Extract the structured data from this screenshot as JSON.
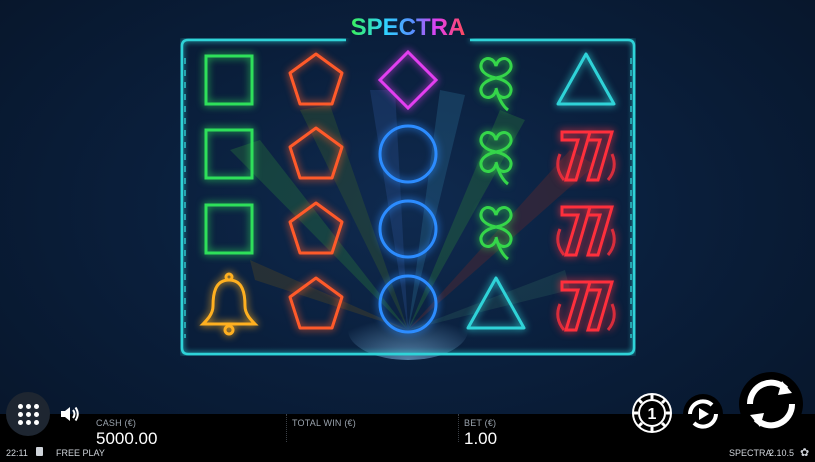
{
  "game": {
    "logo_text": "SPECTRA",
    "reels": [
      [
        "square",
        "square",
        "square",
        "bell"
      ],
      [
        "pentagon",
        "pentagon",
        "pentagon",
        "pentagon"
      ],
      [
        "diamond",
        "circle",
        "circle",
        "circle"
      ],
      [
        "clover",
        "clover",
        "clover",
        "triangle"
      ],
      [
        "triangle",
        "seven",
        "seven",
        "seven"
      ]
    ],
    "symbol_colors": {
      "square": "#2ee05a",
      "pentagon": "#ff5a2a",
      "diamond": "#e23ef0",
      "circle": "#2c8cff",
      "clover": "#35d64a",
      "triangle": "#2fd3d8",
      "seven": "#ff2f3c",
      "bell": "#ffb020"
    },
    "frame_color": "#2fd3d8"
  },
  "meters": {
    "cash_label": "CASH (€)",
    "cash_value": "5000.00",
    "win_label": "TOTAL WIN (€)",
    "win_value": "",
    "bet_label": "BET (€)",
    "bet_value": "1.00"
  },
  "status": {
    "time": "22:11",
    "mode": "FREE PLAY",
    "game_name": "SPECTRA",
    "version": "2.10.5"
  },
  "controls": {
    "coin_value": "1"
  }
}
